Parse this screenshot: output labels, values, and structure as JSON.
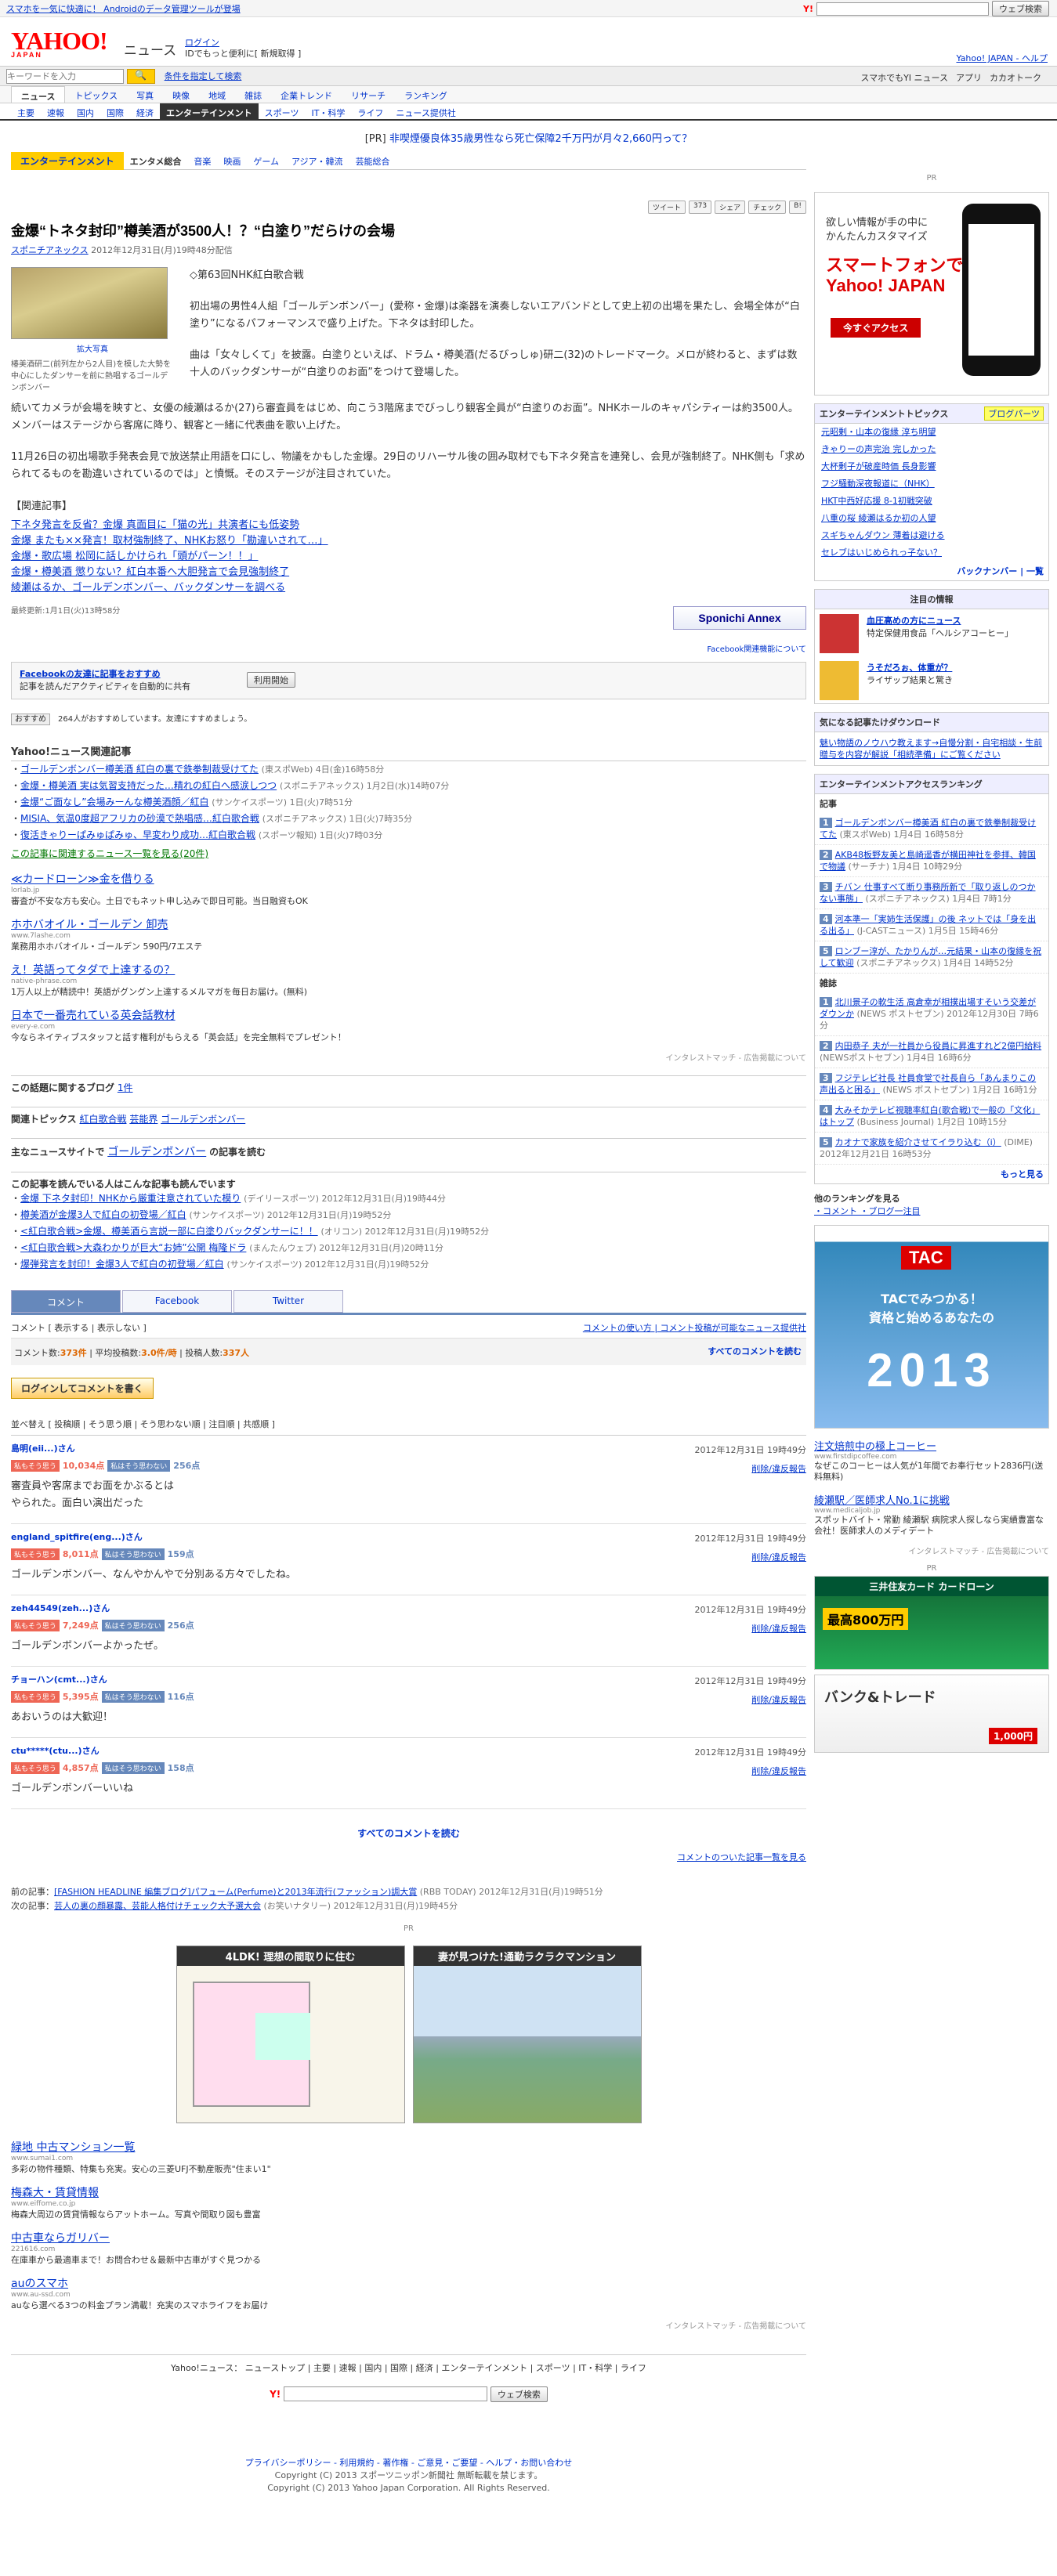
{
  "top": {
    "left_text": "スマホを一気に快適に！ Androidのデータ管理ツールが登場",
    "search_button": "ウェブ検索"
  },
  "header": {
    "logo": "YAHOO!",
    "logo_sub": "JAPAN",
    "service": "ニュース",
    "login": "ログイン",
    "login_sub": "IDでもっと便利に[ 新規取得 ]",
    "links": "Yahoo! JAPAN - ヘルプ"
  },
  "search": {
    "placeholder": "キーワードを入力",
    "adv": "条件を指定して検索",
    "right": [
      "スマホでもYI ニュース",
      "アプリ",
      "カカオトーク"
    ]
  },
  "nav1": [
    "ニュース",
    "トピックス",
    "写真",
    "映像",
    "地域",
    "雑誌",
    "企業トレンド",
    "リサーチ",
    "ランキング"
  ],
  "nav2": [
    "主要",
    "速報",
    "国内",
    "国際",
    "経済",
    "エンターテインメント",
    "スポーツ",
    "IT・科学",
    "ライフ",
    "ニュース提供社"
  ],
  "pr_top": {
    "label": "[PR]",
    "text": "非喫煙優良体35歳男性なら死亡保障2千万円が月々2,660円って？"
  },
  "catbar": [
    "エンターテインメント",
    "エンタメ総合",
    "音楽",
    "映画",
    "ゲーム",
    "アジア・韓流",
    "芸能総合"
  ],
  "share": [
    "ツイート",
    "373",
    "シェア",
    "チェック",
    "B!"
  ],
  "article": {
    "title": "金爆“トネタ封印”樽美酒が3500人！？“白塗り”だらけの会場",
    "source": "スポニチアネックス",
    "date": "2012年12月31日(月)19時48分配信",
    "img_caption": "拡大写真",
    "img_text": "椿美酒研二(前列左から2人目)を模した大勢を中心にしたダンサーを前に熱唱するゴールデンボンバー",
    "p0": "◇第63回NHK紅白歌合戦",
    "p1": "初出場の男性4人組「ゴールデンボンバー」(愛称・金爆)は楽器を演奏しないエアバンドとして史上初の出場を果たし、会場全体が“白塗り”になるパフォーマンスで盛り上げた。下ネタは封印した。",
    "p2": "曲は「女々しくて」を披露。白塗りといえば、ドラム・樽美酒(だるびっしゅ)研二(32)のトレードマーク。メロが終わると、まずは数十人のバックダンサーが“白塗りのお面”をつけて登場した。",
    "p3": "続いてカメラが会場を映すと、女優の綾瀬はるか(27)ら審査員をはじめ、向こう3階席までびっしり観客全員が“白塗りのお面”。NHKホールのキャパシティーは約3500人。メンバーはステージから客席に降り、観客と一緒に代表曲を歌い上げた。",
    "p4": "11月26日の初出場歌手発表会見で放送禁止用語を口にし、物議をかもした金爆。29日のリハーサル後の囲み取材でも下ネタ発言を連発し、会見が強制終了。NHK側も「求められてるものを勘違いされているのでは」と憤慨。そのステージが注目されていた。",
    "rel_title": "【関連記事】",
    "rel": [
      "下ネタ発言を反省？金爆 真面目に「猫の光」共演者にも低姿勢",
      "金爆 またも××発言！取材強制終了、NHKお怒り「勘違いされて…」",
      "金爆・歌広場 松岡に話しかけられ「頭がパーン！！」",
      "金爆・樽美酒 懲りない？紅白本番へ大胆発言で会見強制終了",
      "綾瀬はるか、ゴールデンボンバー、バックダンサーを調べる"
    ],
    "updated": "最終更新:1月1日(火)13時58分",
    "sponi": "Sponichi Annex",
    "fb_note": "Facebook関連機能について"
  },
  "fb": {
    "title": "Facebookの友達に記事をおすすめ",
    "sub": "記事を読んだアクティビティを自動的に共有",
    "button": "利用開始"
  },
  "likes": {
    "btn": "おすすめ",
    "text": "264人がおすすめしています。友達にすすめましょう。"
  },
  "related": {
    "title": "Yahoo!ニュース関連記事",
    "items": [
      {
        "t": "ゴールデンボンバー樽美酒 紅白の裏で鉄拳制裁受けてた",
        "s": "(東スポWeb) 4日(金)16時58分"
      },
      {
        "t": "金爆・樽美酒 実は気習支持だった…精れの紅白へ感涙しつつ",
        "s": "(スポニチアネックス) 1月2日(水)14時07分"
      },
      {
        "t": "金爆“ご面なし”会場みーんな樽美酒顔／紅白",
        "s": "(サンケイスポーツ) 1日(火)7時51分"
      },
      {
        "t": "MISIA、気温0度超アフリカの砂漠で熱唱感…紅白歌合戦",
        "s": "(スポニチアネックス) 1日(火)7時35分"
      },
      {
        "t": "復活きゃりーぱみゅぱみゅ、早変わり成功…紅白歌合戦",
        "s": "(スポーツ報知) 1日(火)7時03分"
      }
    ],
    "more": "この記事に関連するニュース一覧を見る(20件)"
  },
  "ads": [
    {
      "t": "≪カードローン≫金を借りる",
      "u": "lorlab.jp",
      "d": "審査が不安な方も安心。土日でもネット申し込みで即日可能。当日融資もOK"
    },
    {
      "t": "ホホバオイル・ゴールデン 卸売",
      "u": "www.7lashe.com",
      "d": "業務用ホホバオイル・ゴールデン 590円/7エステ"
    },
    {
      "t": "え！英語ってタダで上達するの？",
      "u": "native-phrase.com",
      "d": "1万人以上が精読中！英語がグングン上達するメルマガを毎日お届け。(無料)"
    },
    {
      "t": "日本で一番売れている英会話教材",
      "u": "every-e.com",
      "d": "今ならネイティブスタッフと話す権利がもらえる「英会話」を完全無料でプレゼント！"
    }
  ],
  "ad_note": "インタレストマッチ - 広告掲載について",
  "blog": {
    "t": "この話題に関するブログ",
    "n": "1件"
  },
  "topics": {
    "t": "関連トピックス",
    "items": [
      "紅白歌合戦",
      "芸能界",
      "ゴールデンボンバー"
    ]
  },
  "mainnews": {
    "t": "主なニュースサイトで",
    "k": "ゴールデンボンバー",
    "s": "の記事を読む"
  },
  "alsoread": {
    "t": "この記事を読んでいる人はこんな記事も読んでいます",
    "items": [
      {
        "t": "金爆 下ネタ封印！NHKから厳重注意されていた模り",
        "s": "(デイリースポーツ) 2012年12月31日(月)19時44分"
      },
      {
        "t": "樽美酒が金爆3人で紅白の初登場／紅白",
        "s": "(サンケイスポーツ) 2012年12月31日(月)19時52分"
      },
      {
        "t": "<紅白歌合戦>金爆、樽美酒ら言説一部に白塗りバックダンサーに！！",
        "s": "(オリコン) 2012年12月31日(月)19時52分"
      },
      {
        "t": "<紅白歌合戦>大森わかりが巨大“お姉”公開 梅隆ドラ",
        "s": "(まんたんウェブ) 2012年12月31日(月)20時11分"
      },
      {
        "t": "爆弾発言を封印！金爆3人で紅白の初登場／紅白",
        "s": "(サンケイスポーツ) 2012年12月31日(月)19時52分"
      }
    ]
  },
  "ctabs": [
    "コメント",
    "Facebook",
    "Twitter"
  ],
  "cbar": {
    "a": "コメント [ 表示する | 表示しない ]",
    "b": "コメントの使い方 | コメント投稿が可能なニュース提供社"
  },
  "cstat": {
    "a": "コメント数:",
    "n": "373件",
    "b": "| 平均投稿数:",
    "bn": "3.0件/時",
    "c": "| 投稿人数:",
    "cn": "337人",
    "r": "すべてのコメントを読む"
  },
  "loginbtn": "ログインしてコメントを書く",
  "sort": "並べ替え [ 投稿順 | そう思う順 | そう思わない順 | 注目順 | 共感順 ]",
  "agree_label": "私もそう思う",
  "disagree_label": "私はそう思わない",
  "del_label": "削除/違反報告",
  "comments": [
    {
      "user": "島明(eii...)さん",
      "date": "2012年12月31日 19時49分",
      "ap": "10,034点",
      "dp": "256点",
      "body": "審査員や客席までお面をかぶるとは\nやられた。面白い演出だった"
    },
    {
      "user": "england_spitfire(eng...)さん",
      "date": "2012年12月31日 19時49分",
      "ap": "8,011点",
      "dp": "159点",
      "body": "ゴールデンボンバー、なんやかんやで分別ある方々でしたね。"
    },
    {
      "user": "zeh44549(zeh...)さん",
      "date": "2012年12月31日 19時49分",
      "ap": "7,249点",
      "dp": "256点",
      "body": "ゴールデンボンバーよかったぜ。"
    },
    {
      "user": "チョーハン(cmt...)さん",
      "date": "2012年12月31日 19時49分",
      "ap": "5,395点",
      "dp": "116点",
      "body": "あおいうのは大歓迎！"
    },
    {
      "user": "ctu*****(ctu...)さん",
      "date": "2012年12月31日 19時49分",
      "ap": "4,857点",
      "dp": "158点",
      "body": "ゴールデンボンバーいいね"
    }
  ],
  "allc": "すべてのコメントを読む",
  "clist": "コメントのついた記事一覧を見る",
  "prev": {
    "l": "前の記事：",
    "t": "[FASHION HEADLINE 編集ブログ]パフューム(Perfume)と2013年流行(ファッション)調大賞",
    "s": "(RBB TODAY) 2012年12月31日(月)19時51分"
  },
  "next": {
    "l": "次の記事：",
    "t": "芸人の裏の顔暴露、芸能人格付けチェック大予選大会",
    "s": "(お笑いナタリー) 2012年12月31日(月)19時45分"
  },
  "pr": "PR",
  "houses": [
    "4LDK! 理想の間取りに住む",
    "妻が見つけた!通勤ラクラクマンション"
  ],
  "ads2": [
    {
      "t": "緑地 中古マンション一覧",
      "u": "www.sumai1.com",
      "d": "多彩の物件種類、特集も充実。安心の三菱UFJ不動産販売\"住まい1\""
    },
    {
      "t": "梅森大・賃貸情報",
      "u": "www.eiffome.co.jp",
      "d": "梅森大周辺の賃貸情報ならアットホーム。写真や間取り図も豊富"
    },
    {
      "t": "中古車ならガリバー",
      "u": "221616.com",
      "d": "在庫車から最適車まで！お問合わせ＆最新中古車がすぐ見つかる"
    },
    {
      "t": "auのスマホ",
      "u": "www.au-ssd.com",
      "d": "auなら選べる3つの料金プラン満載！充実のスマホライフをお届け"
    }
  ],
  "bottomlinks": "Yahoo!ニュース： ニューストップ | 主要 | 速報 | 国内 | 国際 | 経済 | エンターテインメント | スポーツ | IT・科学 | ライフ",
  "foot": {
    "l": "プライバシーポリシー - 利用規約 - 著作権 - ご意見・ご要望 - ヘルプ・お問い合わせ",
    "c1": "Copyright (C) 2013 スポーツニッポン新聞社 無断転載を禁じます。",
    "c2": "Copyright (C) 2013 Yahoo Japan Corporation. All Rights Reserved."
  },
  "side": {
    "pr": "PR",
    "phone": {
      "t1": "欲しい情報が手の中に\nかんたんカスタマイズ",
      "t2": "スマートフォンでも\nYahoo! JAPAN",
      "b": "今すぐアクセス"
    },
    "ent": {
      "h": "エンターテインメントトピックス",
      "r": "ブログパーツ",
      "items": [
        "元昭剰・山本の復縁 淳ち明望",
        "きゃりーの声完治 完しかった",
        "大杯剰子が破産時価 長身影響",
        "フジ騒動深夜報道に（NHK）",
        "HKT中西好応援 8-1初戦突破",
        "八重の桜 綾瀬はるか初の人望",
        "スギちゃんダウン 薄着は避ける",
        "セレブはいじめられっ子ない？"
      ],
      "ft": "バックナンバー | 一覧"
    },
    "info": {
      "h": "注目の情報",
      "i1": "血圧高めの方にニュース",
      "i2": "うそだろぉ、体重が？",
      "d1": "特定保健用食品「ヘルシアコーヒー」",
      "d2": "ライザップ結果と驚き"
    },
    "dl": {
      "h": "気になる記事たけダウンロード",
      "d": "魅い物語のノウハウ教えます→自慢分割・自宅相談・生前贈与を内容が解説「相続準備」にご覧ください"
    },
    "rank": {
      "h": "エンターテインメントアクセスランキング",
      "sec1": "記事",
      "items": [
        {
          "n": "1",
          "t": "ゴールデンボンバー樽美酒 紅白の裏で鉄拳制裁受けてた",
          "s": "(東スポWeb) 1月4日 16時58分"
        },
        {
          "n": "2",
          "t": "AKB48板野友美と島崎遥香が横田神社を参拝、韓国で物議",
          "s": "(サーチナ) 1月4日 10時29分"
        },
        {
          "n": "3",
          "t": "チバン 仕事すべて断り事務所新で「取り返しのつかない事態」",
          "s": "(スポニチアネックス) 1月4日 7時1分"
        },
        {
          "n": "4",
          "t": "河本準一「実姉生活保護」の後 ネットでは「身を出る出る」",
          "s": "(J-CASTニュース) 1月5日 15時46分"
        },
        {
          "n": "5",
          "t": "ロンブー淳が、たかりんが…元結果・山本の復縁を祝して歓迎",
          "s": "(スポニチアネックス) 1月4日 14時52分"
        }
      ],
      "sec2": "雑誌",
      "mag": [
        {
          "n": "1",
          "t": "北川景子の軟生活 高倉幸が相撲出場すそいう交差がダウンか",
          "s": "(NEWS ポストセブン) 2012年12月30日 7時6分"
        },
        {
          "n": "2",
          "t": "内田恭子 夫が一社員から役員に昇進すれど2億円給料",
          "s": "(NEWSポストセブン) 1月4日 16時6分"
        },
        {
          "n": "3",
          "t": "フジテレビ社長 社員食堂で社長自ら「あんまりこの声出ると困る」",
          "s": "(NEWS ポストセブン) 1月2日 16時1分"
        },
        {
          "n": "4",
          "t": "大みそかテレビ視聴率紅白(歌合戦)で一般の「文化」はトップ",
          "s": "(Business Journal) 1月2日 10時15分"
        },
        {
          "n": "5",
          "t": "カオナで家族を紹介させてイラり込む（i）",
          "s": "(DIME) 2012年12月21日 16時53分"
        }
      ],
      "more": "もっと見る"
    },
    "other": {
      "h": "他のランキングを見る",
      "items": "・コメント ・ブログ一注目"
    },
    "tac": {
      "a": "TAC",
      "b": "TACでみつかる！\n資格と始めるあなたの",
      "c": "2013"
    },
    "sads": [
      {
        "t": "注文焙煎中の極上コーヒー",
        "u": "www.firstdipcoffee.com",
        "d": "なぜこのコーヒーは人気が1年間でお奉行セット2836円(送料無料)"
      },
      {
        "t": "綾瀬駅／医師求人No.1に挑戦",
        "u": "www.medicaljob.jp",
        "d": "スポットバイト・常勤 綾瀬駅 病院求人探しなら実績豊富な会社！医師求人のメディデート"
      }
    ],
    "card": {
      "t": "三井住友カード カードローン",
      "n": "最高800万円"
    },
    "band": {
      "t": "バンク&トレード",
      "p": "1,000円"
    }
  }
}
